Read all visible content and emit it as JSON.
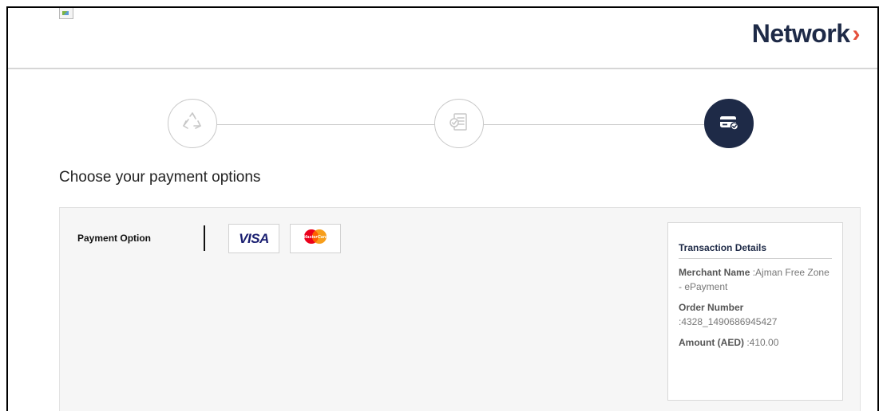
{
  "header": {
    "brand_name": "Network",
    "brand_chevron": "›",
    "brand_color": "#1e2a47",
    "chevron_color": "#e5503c"
  },
  "stepper": {
    "steps": [
      {
        "icon": "recycle-icon",
        "state": "inactive"
      },
      {
        "icon": "checklist-document-icon",
        "state": "inactive"
      },
      {
        "icon": "credit-card-check-icon",
        "state": "active"
      }
    ],
    "active_color": "#1e2a47",
    "inactive_color": "#c8c8c8"
  },
  "main": {
    "title": "Choose your payment options"
  },
  "payment": {
    "label": "Payment Option",
    "cards": [
      {
        "name": "visa",
        "text": "VISA"
      },
      {
        "name": "mastercard",
        "text": "MasterCard"
      }
    ]
  },
  "transaction": {
    "title": "Transaction Details",
    "merchant_key": "Merchant Name",
    "merchant_value": ":Ajman Free Zone - ePayment",
    "order_key": "Order Number",
    "order_value": ":4328_1490686945427",
    "amount_key": "Amount (AED)",
    "amount_value": ":410.00"
  }
}
